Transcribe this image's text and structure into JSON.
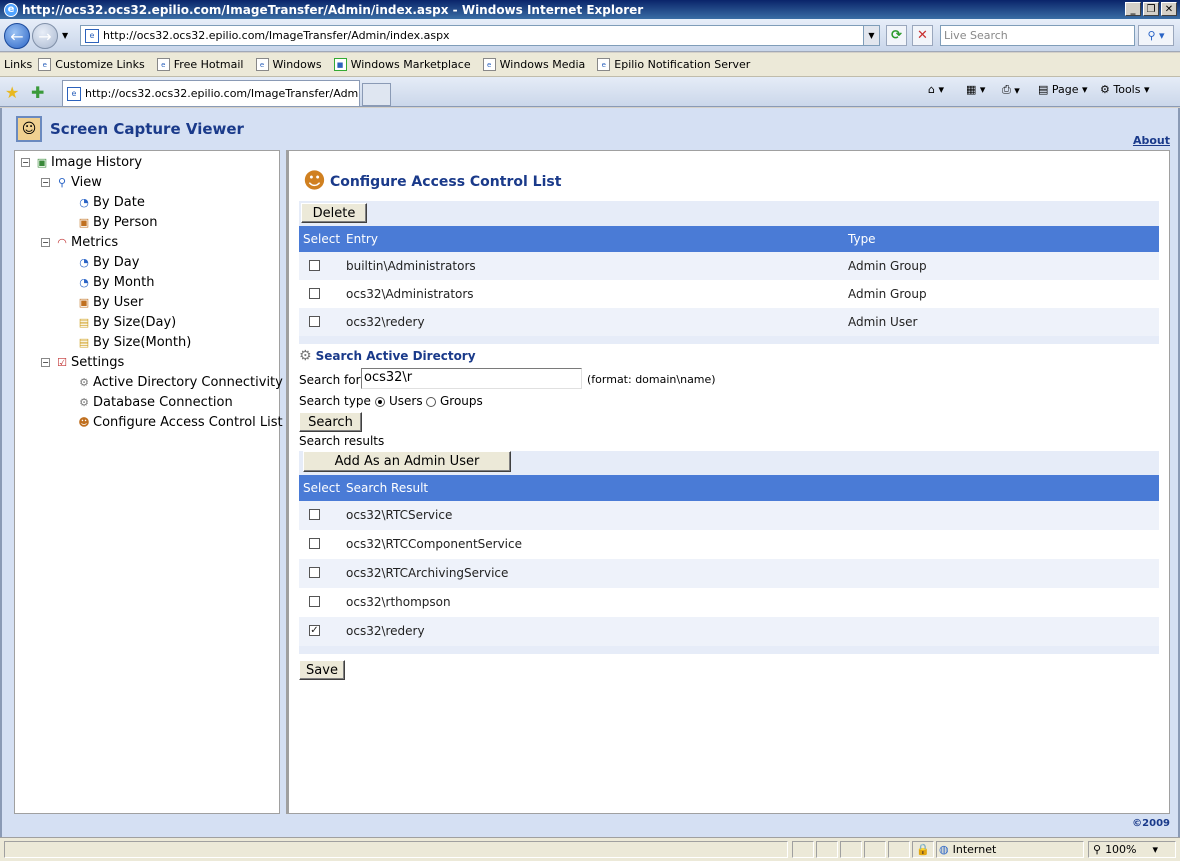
{
  "window": {
    "title": "http://ocs32.ocs32.epilio.com/ImageTransfer/Admin/index.aspx - Windows Internet Explorer"
  },
  "address": {
    "url": "http://ocs32.ocs32.epilio.com/ImageTransfer/Admin/index.aspx",
    "search_placeholder": "Live Search"
  },
  "links": {
    "label": "Links",
    "items": [
      "Customize Links",
      "Free Hotmail",
      "Windows",
      "Windows Marketplace",
      "Windows Media",
      "Epilio Notification Server"
    ]
  },
  "tab": {
    "title": "http://ocs32.ocs32.epilio.com/ImageTransfer/Admin/i..."
  },
  "commands": {
    "page": "Page",
    "tools": "Tools"
  },
  "app": {
    "title": "Screen Capture Viewer",
    "about": "About",
    "copyright": "©2009"
  },
  "tree": {
    "root": "Image History",
    "view": "View",
    "by_date": "By Date",
    "by_person": "By Person",
    "metrics": "Metrics",
    "by_day": "By Day",
    "by_month": "By Month",
    "by_user": "By User",
    "by_size_day": "By Size(Day)",
    "by_size_month": "By Size(Month)",
    "settings": "Settings",
    "ad_conn": "Active Directory Connectivity",
    "db_conn": "Database Connection",
    "acl": "Configure Access Control List"
  },
  "acl": {
    "heading": "Configure Access Control List",
    "delete_label": "Delete",
    "columns": {
      "select": "Select",
      "entry": "Entry",
      "type": "Type"
    },
    "rows": [
      {
        "entry": "builtin\\Administrators",
        "type": "Admin Group",
        "checked": false
      },
      {
        "entry": "ocs32\\Administrators",
        "type": "Admin Group",
        "checked": false
      },
      {
        "entry": "ocs32\\redery",
        "type": "Admin User",
        "checked": false
      }
    ]
  },
  "ad_search": {
    "heading": "Search Active Directory",
    "search_for_label": "Search for",
    "search_for_value": "ocs32\\r",
    "format_hint": "(format: domain\\name)",
    "search_type_label": "Search type",
    "users_label": "Users",
    "groups_label": "Groups",
    "selected_type": "Users",
    "search_button": "Search",
    "results_label": "Search results",
    "add_button": "Add As an Admin User",
    "columns": {
      "select": "Select",
      "result": "Search Result"
    },
    "results": [
      {
        "name": "ocs32\\RTCService",
        "checked": false
      },
      {
        "name": "ocs32\\RTCComponentService",
        "checked": false
      },
      {
        "name": "ocs32\\RTCArchivingService",
        "checked": false
      },
      {
        "name": "ocs32\\rthompson",
        "checked": false
      },
      {
        "name": "ocs32\\redery",
        "checked": true
      }
    ],
    "save_button": "Save"
  },
  "status": {
    "zone": "Internet",
    "zoom": "100%"
  }
}
